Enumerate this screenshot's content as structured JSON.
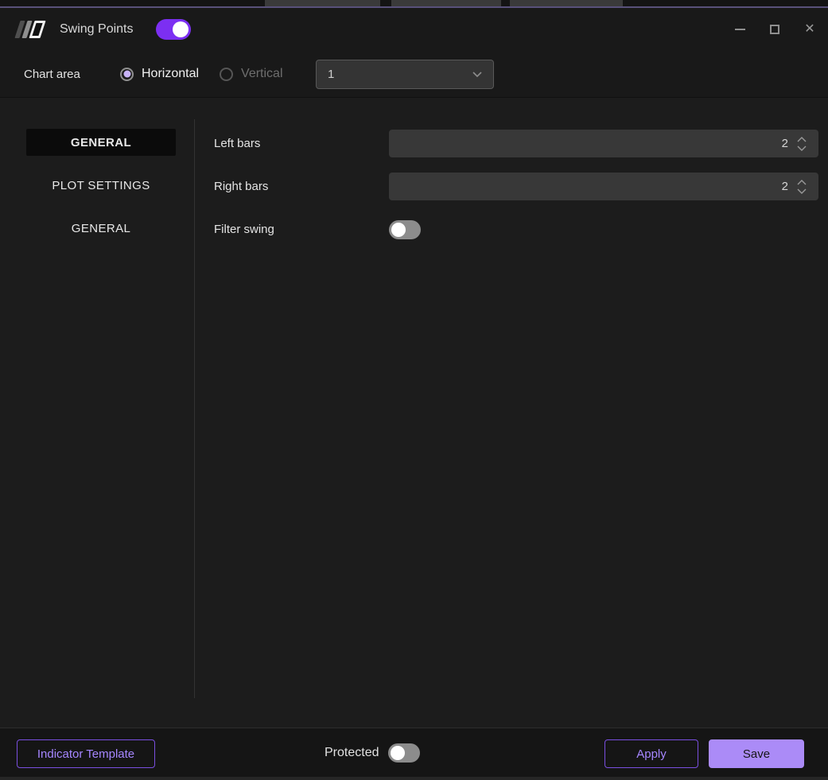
{
  "colors": {
    "accent_purple": "#7c2ff2",
    "lavender": "#ab8bf7",
    "outline_purple": "#7a4fe0",
    "toggle_off_gray": "#8c8c8c"
  },
  "titlebar": {
    "title": "Swing Points",
    "indicator_enabled": true,
    "close_glyph": "✕"
  },
  "chart_area_bar": {
    "label": "Chart area",
    "orientation_options": [
      {
        "label": "Horizontal",
        "selected": true
      },
      {
        "label": "Vertical",
        "selected": false
      }
    ],
    "pane_select": {
      "value": "1"
    }
  },
  "sidebar": {
    "items": [
      {
        "label": "GENERAL",
        "active": true
      },
      {
        "label": "PLOT SETTINGS",
        "active": false
      },
      {
        "label": "GENERAL",
        "active": false
      }
    ]
  },
  "settings": {
    "rows": [
      {
        "label": "Left bars",
        "type": "number",
        "value": "2"
      },
      {
        "label": "Right bars",
        "type": "number",
        "value": "2"
      },
      {
        "label": "Filter swing",
        "type": "toggle",
        "value": false
      }
    ]
  },
  "footer": {
    "indicator_template_label": "Indicator Template",
    "protected_label": "Protected",
    "protected_on": false,
    "apply_label": "Apply",
    "save_label": "Save"
  }
}
